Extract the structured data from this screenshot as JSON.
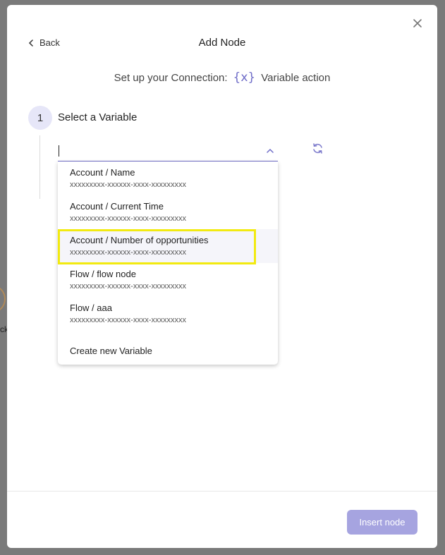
{
  "backdrop": {
    "partial_text": "ck"
  },
  "modal": {
    "title": "Add Node",
    "back_label": "Back",
    "subtitle_prefix": "Set up your Connection:",
    "subtitle_icon": "{x}",
    "subtitle_action": "Variable action"
  },
  "step": {
    "number": "1",
    "label": "Select a Variable"
  },
  "select": {
    "value": "",
    "expanded": true
  },
  "dropdown": {
    "items": [
      {
        "title": "Account / Name",
        "subtitle": "xxxxxxxxx-xxxxxx-xxxx-xxxxxxxxx"
      },
      {
        "title": "Account / Current Time",
        "subtitle": "xxxxxxxxx-xxxxxx-xxxx-xxxxxxxxx"
      },
      {
        "title": "Account / Number of opportunities",
        "subtitle": "xxxxxxxxx-xxxxxx-xxxx-xxxxxxxxx"
      },
      {
        "title": "Flow / flow node",
        "subtitle": "xxxxxxxxx-xxxxxx-xxxx-xxxxxxxxx"
      },
      {
        "title": "Flow / aaa",
        "subtitle": "xxxxxxxxx-xxxxxx-xxxx-xxxxxxxxx"
      }
    ],
    "create_label": "Create new Variable"
  },
  "footer": {
    "insert_label": "Insert node"
  },
  "colors": {
    "accent": "#6f6dc8",
    "insert_button": "#a6a4e0",
    "highlight_border": "#f2ea10",
    "step_circle": "#e6e6f8"
  },
  "icons": {
    "close": "close-icon",
    "back": "chevron-left-icon",
    "variable": "variable-icon",
    "dropdown": "chevron-up-icon",
    "refresh": "refresh-icon"
  }
}
